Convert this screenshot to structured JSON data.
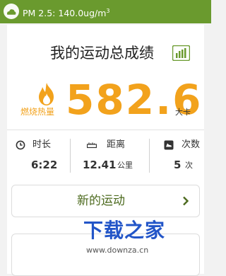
{
  "status_bar": {
    "pm_label": "PM 2.5: 140.0ug/m",
    "pm_superscript": "3",
    "weather_icon": "cloud-icon",
    "bg_color": "#6a9a2e"
  },
  "header": {
    "title": "我的运动总成绩",
    "chart_icon": "bar-chart-icon"
  },
  "burn": {
    "label": "燃烧热量",
    "value": "582.6",
    "unit": "大卡",
    "icon": "flame-icon",
    "color": "#f2a21c"
  },
  "stats": [
    {
      "label": "时长",
      "value": "6:22",
      "unit": "",
      "icon": "clock-icon"
    },
    {
      "label": "距离",
      "value": "12.41",
      "unit": "公里",
      "icon": "ruler-icon"
    },
    {
      "label": "次数",
      "value": "5",
      "unit": "次",
      "icon": "shoe-icon"
    }
  ],
  "actions": {
    "new_workout_label": "新的运动",
    "chevron_icon": "chevron-right-icon"
  },
  "watermark": {
    "logo_text": "下载之家",
    "url": "www.downza.cn"
  }
}
